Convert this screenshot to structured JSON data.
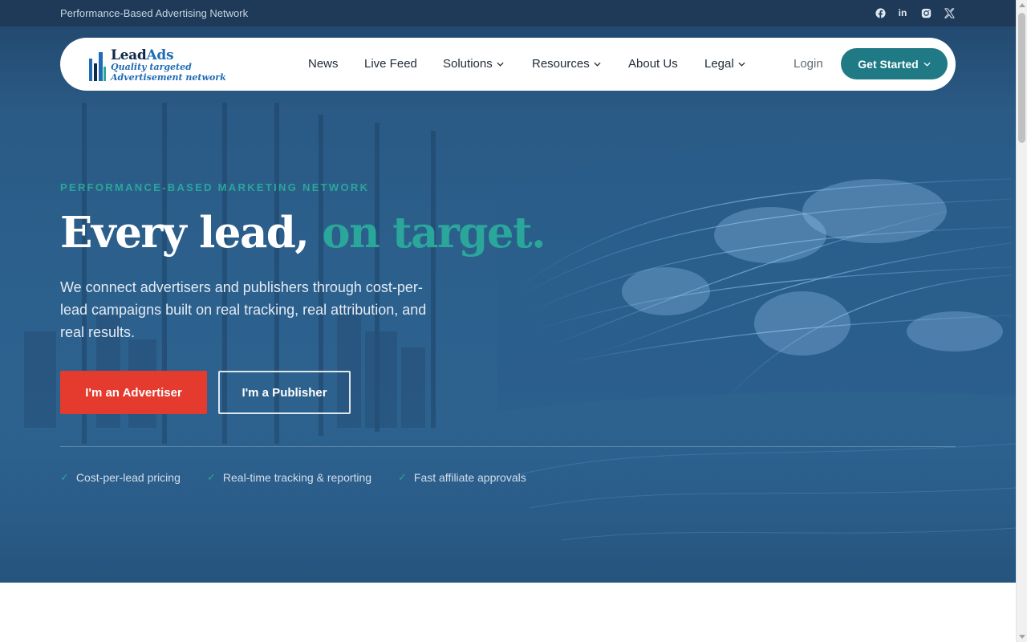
{
  "topbar": {
    "tagline": "Performance-Based Advertising Network",
    "social": [
      {
        "icon": "facebook-icon"
      },
      {
        "icon": "linkedin-icon",
        "glyph": "in"
      },
      {
        "icon": "instagram-icon"
      },
      {
        "icon": "x-twitter-icon"
      }
    ]
  },
  "nav": {
    "logo": {
      "name_main": "Lead",
      "name_accent": "Ads",
      "tag_line1": "Quality targeted",
      "tag_line2": "Advertisement network"
    },
    "items": [
      {
        "label": "News",
        "dropdown": false
      },
      {
        "label": "Live Feed",
        "dropdown": false
      },
      {
        "label": "Solutions",
        "dropdown": true
      },
      {
        "label": "Resources",
        "dropdown": true
      },
      {
        "label": "About Us",
        "dropdown": false
      },
      {
        "label": "Legal",
        "dropdown": true
      }
    ],
    "login": "Login",
    "cta": "Get Started"
  },
  "hero": {
    "eyebrow": "PERFORMANCE-BASED MARKETING NETWORK",
    "headline_main": "Every lead, ",
    "headline_accent": "on target.",
    "subcopy": "We connect advertisers and publishers through cost-per-lead campaigns built on real tracking, real attribution, and real results.",
    "btn_advertiser": "I'm an Advertiser",
    "btn_publisher": "I'm a Publisher",
    "features": [
      "Cost-per-lead pricing",
      "Real-time tracking & reporting",
      "Fast affiliate approvals"
    ],
    "check_glyph": "✓"
  },
  "colors": {
    "accent_teal": "#2aa69b",
    "cta_red": "#e53a2e",
    "nav_cta": "#1f7a86",
    "hero_bg": "#2c5f8c",
    "topbar_bg": "#1e3a58"
  }
}
